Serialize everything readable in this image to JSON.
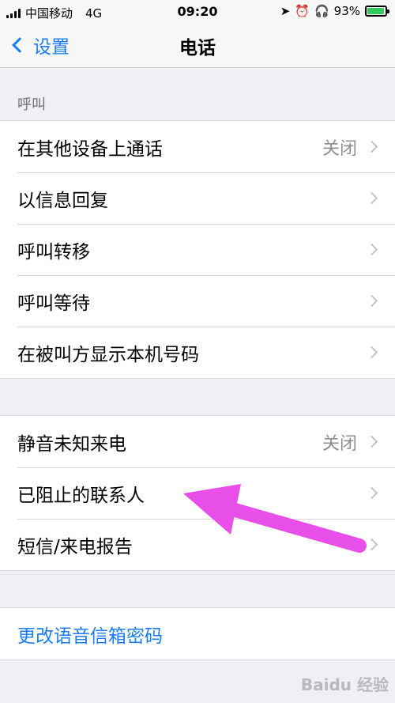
{
  "status_bar": {
    "carrier": "中国移动",
    "network": "4G",
    "time": "09:20",
    "battery_percent": "93%",
    "battery_level": 0.93
  },
  "nav": {
    "back_label": "设置",
    "title": "电话"
  },
  "sections": {
    "calls_header": "呼叫",
    "calls": [
      {
        "label": "在其他设备上通话",
        "value": "关闭"
      },
      {
        "label": "以信息回复",
        "value": ""
      },
      {
        "label": "呼叫转移",
        "value": ""
      },
      {
        "label": "呼叫等待",
        "value": ""
      },
      {
        "label": "在被叫方显示本机号码",
        "value": ""
      }
    ],
    "silence": [
      {
        "label": "静音未知来电",
        "value": "关闭"
      },
      {
        "label": "已阻止的联系人",
        "value": ""
      },
      {
        "label": "短信/来电报告",
        "value": ""
      }
    ],
    "voicemail": {
      "label": "更改语音信箱密码"
    }
  },
  "colors": {
    "accent": "#1a7ef2",
    "annotation_arrow": "#e84ee8",
    "battery": "#34c759"
  },
  "watermark": "Baidu 经验"
}
